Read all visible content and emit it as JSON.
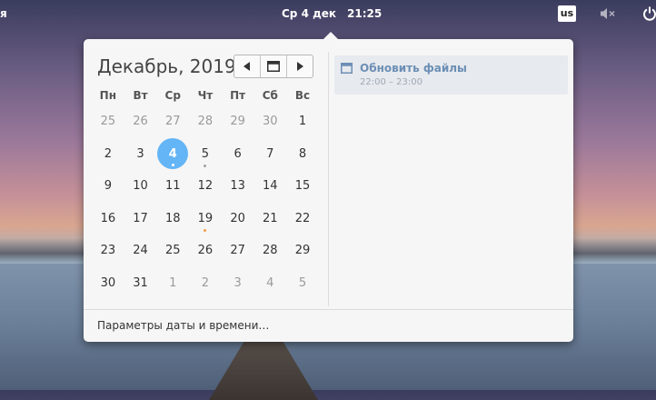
{
  "panel": {
    "left_fragment": "я",
    "date": "Ср  4 дек",
    "time": "21:25",
    "keyboard_layout": "us"
  },
  "calendar": {
    "month_title": "Декабрь, 2019",
    "weekdays": [
      "Пн",
      "Вт",
      "Ср",
      "Чт",
      "Пт",
      "Сб",
      "Вс"
    ],
    "weeks": [
      [
        {
          "d": "25",
          "other": true
        },
        {
          "d": "26",
          "other": true
        },
        {
          "d": "27",
          "other": true
        },
        {
          "d": "28",
          "other": true
        },
        {
          "d": "29",
          "other": true
        },
        {
          "d": "30",
          "other": true
        },
        {
          "d": "1"
        }
      ],
      [
        {
          "d": "2"
        },
        {
          "d": "3"
        },
        {
          "d": "4",
          "today": true,
          "dot": "white"
        },
        {
          "d": "5",
          "dot": "grey"
        },
        {
          "d": "6"
        },
        {
          "d": "7"
        },
        {
          "d": "8"
        }
      ],
      [
        {
          "d": "9"
        },
        {
          "d": "10"
        },
        {
          "d": "11"
        },
        {
          "d": "12"
        },
        {
          "d": "13"
        },
        {
          "d": "14"
        },
        {
          "d": "15"
        }
      ],
      [
        {
          "d": "16"
        },
        {
          "d": "17"
        },
        {
          "d": "18"
        },
        {
          "d": "19",
          "dot": "orange"
        },
        {
          "d": "20"
        },
        {
          "d": "21"
        },
        {
          "d": "22"
        }
      ],
      [
        {
          "d": "23"
        },
        {
          "d": "24"
        },
        {
          "d": "25"
        },
        {
          "d": "26"
        },
        {
          "d": "27"
        },
        {
          "d": "28"
        },
        {
          "d": "29"
        }
      ],
      [
        {
          "d": "30"
        },
        {
          "d": "31"
        },
        {
          "d": "1",
          "other": true
        },
        {
          "d": "2",
          "other": true
        },
        {
          "d": "3",
          "other": true
        },
        {
          "d": "4",
          "other": true
        },
        {
          "d": "5",
          "other": true
        }
      ]
    ]
  },
  "event": {
    "title": "Обновить файлы",
    "time": "22:00 – 23:00"
  },
  "footer": {
    "settings_label": "Параметры даты и времени…"
  },
  "colors": {
    "today_bg": "#64b5f6",
    "event_text": "#6c8fb5",
    "dot_orange": "#f39c4b"
  }
}
